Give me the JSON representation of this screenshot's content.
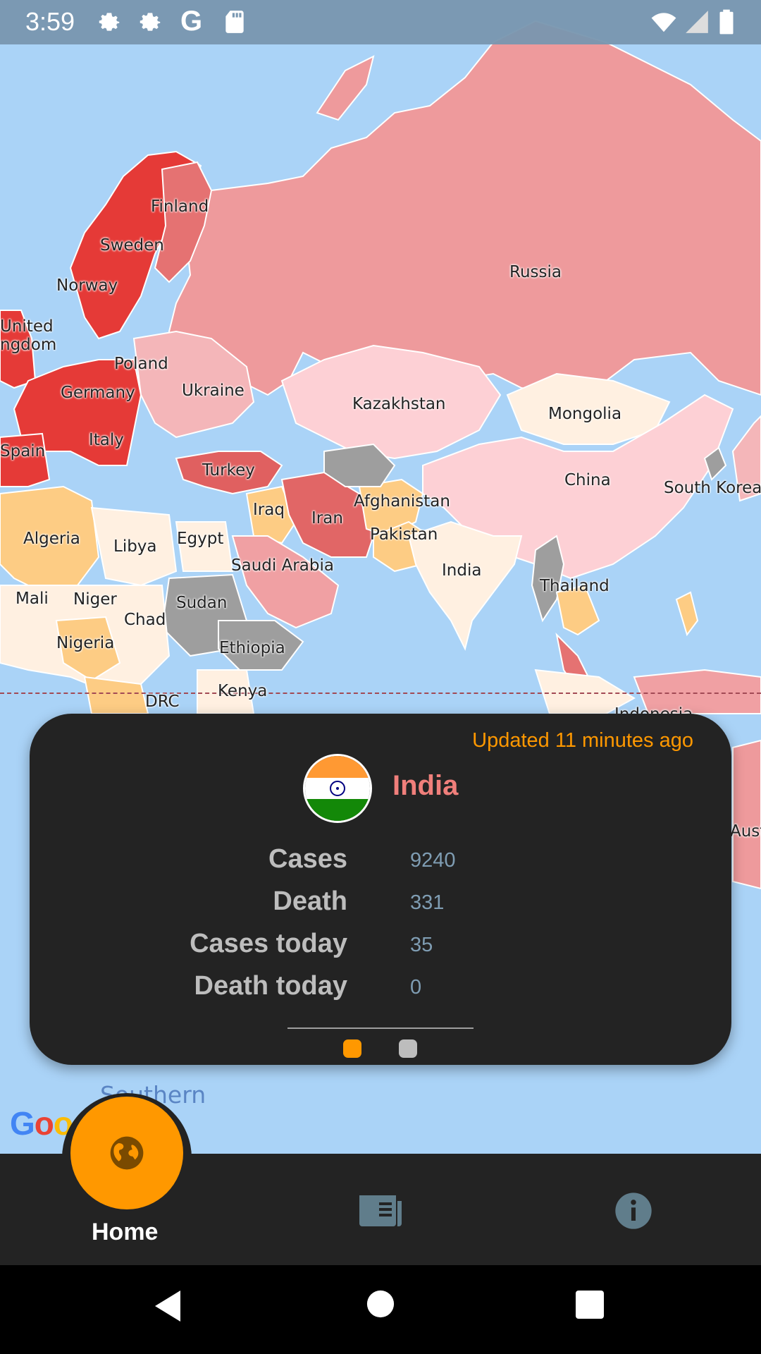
{
  "status_bar": {
    "time": "3:59",
    "icons": [
      "gear-icon",
      "gear-icon",
      "google-icon",
      "sd-card-icon",
      "wifi-icon",
      "signal-icon",
      "battery-icon"
    ]
  },
  "map": {
    "labels": {
      "finland": "Finland",
      "sweden": "Sweden",
      "norway": "Norway",
      "united_kingdom_1": "United",
      "united_kingdom_2": "ngdom",
      "poland": "Poland",
      "germany": "Germany",
      "ukraine": "Ukraine",
      "italy": "Italy",
      "spain": "Spain",
      "turkey": "Turkey",
      "russia": "Russia",
      "kazakhstan": "Kazakhstan",
      "mongolia": "Mongolia",
      "china": "China",
      "south_korea": "South Korea",
      "iraq": "Iraq",
      "iran": "Iran",
      "afghanistan": "Afghanistan",
      "pakistan": "Pakistan",
      "india": "India",
      "thailand": "Thailand",
      "algeria": "Algeria",
      "libya": "Libya",
      "egypt": "Egypt",
      "saudi_arabia": "Saudi Arabia",
      "mali": "Mali",
      "niger": "Niger",
      "sudan": "Sudan",
      "chad": "Chad",
      "nigeria": "Nigeria",
      "ethiopia": "Ethiopia",
      "kenya": "Kenya",
      "drc": "DRC",
      "indonesia": "Indonesia",
      "australia": "Austra"
    },
    "ocean_label": "Southern",
    "google_logo": "Goo"
  },
  "card": {
    "updated": "Updated 11 minutes ago",
    "country": "India",
    "stats": [
      {
        "label": "Cases",
        "value": "9240"
      },
      {
        "label": "Death",
        "value": "331"
      },
      {
        "label": "Cases today",
        "value": "35"
      },
      {
        "label": "Death today",
        "value": "0"
      }
    ],
    "page_indicator": {
      "active": 0,
      "count": 2
    }
  },
  "bottom_nav": {
    "items": [
      {
        "label": "Home",
        "icon": "globe-icon",
        "active": true
      },
      {
        "label": "",
        "icon": "news-icon",
        "active": false
      },
      {
        "label": "",
        "icon": "info-icon",
        "active": false
      }
    ]
  },
  "colors": {
    "accent": "#ff9800",
    "country_name": "#f07f7b",
    "card_bg": "#232323",
    "ocean": "#aad3f7"
  }
}
